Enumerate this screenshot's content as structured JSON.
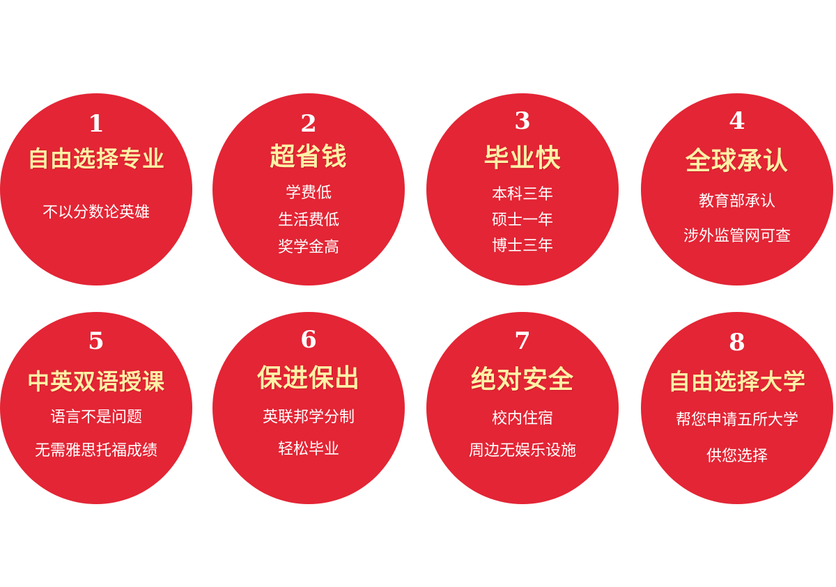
{
  "colors": {
    "circle": "#e32535",
    "heading": "#fff1a6",
    "text": "#ffffff",
    "background": "#ffffff"
  },
  "items": [
    {
      "number": "1",
      "heading": "自由选择专业",
      "lines": [
        "不以分数论英雄"
      ]
    },
    {
      "number": "2",
      "heading": "超省钱",
      "lines": [
        "学费低",
        "生活费低",
        "奖学金高"
      ]
    },
    {
      "number": "3",
      "heading": "毕业快",
      "lines": [
        "本科三年",
        "硕士一年",
        "博士三年"
      ]
    },
    {
      "number": "4",
      "heading": "全球承认",
      "lines": [
        "教育部承认",
        "涉外监管网可查"
      ]
    },
    {
      "number": "5",
      "heading": "中英双语授课",
      "lines": [
        "语言不是问题",
        "无需雅思托福成绩"
      ]
    },
    {
      "number": "6",
      "heading": "保进保出",
      "lines": [
        "英联邦学分制",
        "轻松毕业"
      ]
    },
    {
      "number": "7",
      "heading": "绝对安全",
      "lines": [
        "校内住宿",
        "周边无娱乐设施"
      ]
    },
    {
      "number": "8",
      "heading": "自由选择大学",
      "lines": [
        "帮您申请五所大学",
        "供您选择"
      ]
    }
  ]
}
